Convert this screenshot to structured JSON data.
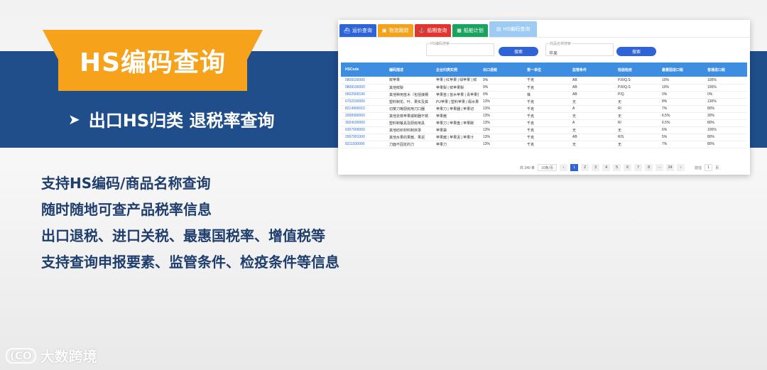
{
  "slide": {
    "title": "HS编码查询",
    "subtitle_arrow": "➤",
    "subtitle": "出口HS归类 退税率查询",
    "features": [
      "支持HS编码/商品名称查询",
      "随时随地可查产品税率信息",
      "出口退税、进口关税、最惠国税率、增值税等",
      "支持查询申报要素、监管条件、检疫条件等信息"
    ],
    "logo_mark": "(CO",
    "logo_text": "大数跨境"
  },
  "app": {
    "tabs": [
      {
        "label": "运价查询",
        "icon": "ship-icon",
        "glyph": "⛴",
        "color": "#2f63d8"
      },
      {
        "label": "物流跟踪",
        "icon": "box-icon",
        "glyph": "▣",
        "color": "#f2a21b"
      },
      {
        "label": "船期查询",
        "icon": "anchor-icon",
        "glyph": "⚓",
        "color": "#e0362f"
      },
      {
        "label": "船舶计划",
        "icon": "calendar-icon",
        "glyph": "▦",
        "color": "#1aa260"
      },
      {
        "label": "HS编码查询",
        "icon": "code-icon",
        "glyph": "▤",
        "color": "#9ecbf4"
      }
    ],
    "hs_field": {
      "label": "HS编码搜索",
      "value": ""
    },
    "name_field": {
      "label": "商品名称搜索",
      "value": "苹果"
    },
    "search_button_1": "搜索",
    "search_button_2": "搜索",
    "table": {
      "columns": [
        "HSCode",
        "编码描述",
        "企业归类实例",
        "出口退税",
        "第一单位",
        "监管条件",
        "检验检疫",
        "最惠国进口税",
        "普通进口税"
      ],
      "rows": [
        [
          "0808100000",
          "鲜苹果",
          "苹果 | 红苹果 | 绿苹果 | 鲜",
          "9%",
          "千克",
          "AB",
          "P.R/Q.S",
          "10%",
          "100%"
        ],
        [
          "0808100000",
          "其他鲜梨",
          "苹果梨 | 鲜苹果梨",
          "9%",
          "千克",
          "AB",
          "P.R/Q.S",
          "10%",
          "100%"
        ],
        [
          "0602909190",
          "其他种用苗木（包括接穗",
          "苹果苗 | 苗木苹果 | 青苹果苗",
          "0%",
          "株",
          "AB",
          "P/Q",
          "0%",
          "0%"
        ],
        [
          "6702100000",
          "塑料制花、叶、果实及其",
          "PU苹果 | 塑料苹果 | 假水果",
          "13%",
          "千克",
          "无",
          "无",
          "8%",
          "130%"
        ],
        [
          "8214900010",
          "切菜刀等厨房用刀口器",
          "苹果刀 | 苹果器 | 苹果切",
          "13%",
          "千克",
          "A",
          "R/",
          "7%",
          "80%"
        ],
        [
          "2008300000",
          "其他去核苹果或制器不锈",
          "苹果酱",
          "13%",
          "千克",
          "无",
          "无",
          "6.5%",
          "30%"
        ],
        [
          "3924100000",
          "塑料制餐具及厨房用具",
          "苹果刀 | 苹果盘 | 苹果碗",
          "13%",
          "千克",
          "A",
          "R/",
          "6.5%",
          "80%"
        ],
        [
          "6307909000",
          "其他纺织材料制床罩",
          "苹果袋",
          "13%",
          "千克",
          "无",
          "无",
          "6%",
          "100%"
        ],
        [
          "2007991000",
          "其他水果的果酱、果泥",
          "苹果酱 | 苹果泥 | 苹果汁",
          "13%",
          "千克",
          "AB",
          "R/S",
          "5%",
          "80%"
        ],
        [
          "8211930000",
          "刀面不固定的刀",
          "苹果刀",
          "13%",
          "千克",
          "无",
          "无",
          "7%",
          "80%"
        ]
      ]
    },
    "pager": {
      "total": "共 240 条",
      "size": "10条/页",
      "prev": "‹",
      "pages": [
        "1",
        "2",
        "3",
        "4",
        "5",
        "6",
        "7",
        "8",
        "···",
        "24"
      ],
      "next": "›",
      "goto_label": "前往",
      "goto_value": "1",
      "goto_suffix": "页"
    }
  }
}
